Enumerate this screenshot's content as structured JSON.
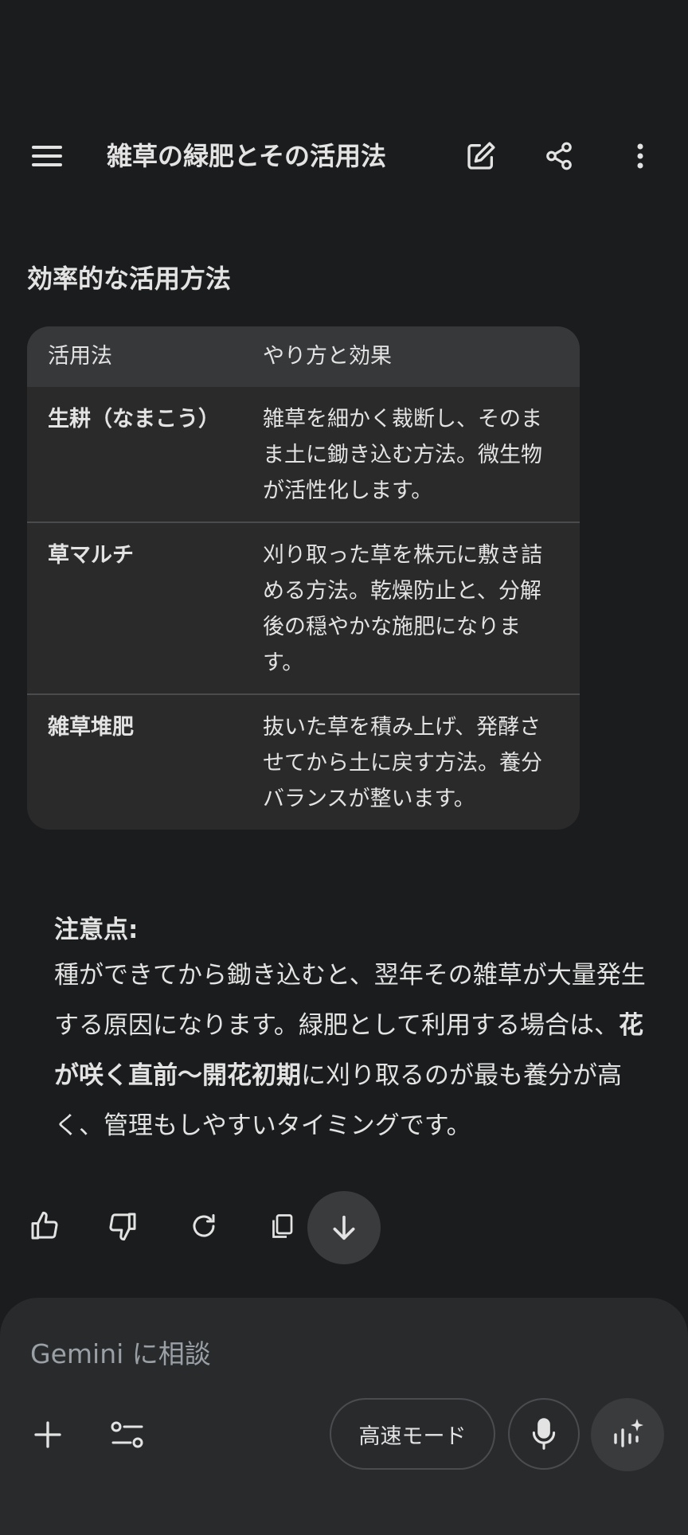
{
  "header": {
    "title": "雑草の緑肥とその活用法"
  },
  "content": {
    "section_heading": "効率的な活用方法",
    "table": {
      "headers": [
        "活用法",
        "やり方と効果"
      ],
      "rows": [
        [
          "生耕（なまこう）",
          "雑草を細かく裁断し、そのまま土に鋤き込む方法。微生物が活性化します。"
        ],
        [
          "草マルチ",
          "刈り取った草を株元に敷き詰める方法。乾燥防止と、分解後の穏やかな施肥になります。"
        ],
        [
          "雑草堆肥",
          "抜いた草を積み上げ、発酵させてから土に戻す方法。養分バランスが整います。"
        ]
      ]
    },
    "note": {
      "label": "注意点:",
      "text_before": "種ができてから鋤き込むと、翌年その雑草が大量発生する原因になります。緑肥として利用する場合は、",
      "bold_text": "花が咲く直前〜開花初期",
      "text_after": "に刈り取るのが最も養分が高く、管理もしやすいタイミングです。"
    }
  },
  "composer": {
    "placeholder": "Gemini に相談",
    "mode_label": "高速モード"
  },
  "icons": {
    "menu": "hamburger-menu-icon",
    "edit": "edit-icon",
    "share": "share-icon",
    "more": "more-vert-icon",
    "like": "thumb-up-icon",
    "dislike": "thumb-down-icon",
    "redo": "refresh-icon",
    "copy": "copy-icon",
    "scroll_down": "arrow-down-icon",
    "add": "plus-icon",
    "tools": "tune-icon",
    "mic": "mic-icon",
    "live": "gemini-live-icon"
  },
  "colors": {
    "background": "#1b1c1d",
    "surface": "#2a2a2b",
    "table_header": "#37383a",
    "text": "#e3e3e3",
    "placeholder": "#9aa0a6"
  }
}
